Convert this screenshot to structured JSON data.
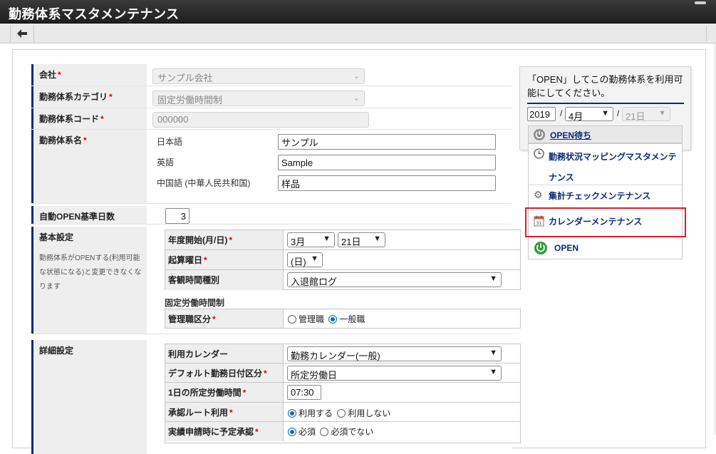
{
  "app": {
    "title": "勤務体系マスタメンテナンス"
  },
  "form": {
    "company": {
      "label": "会社",
      "value": "サンプル会社"
    },
    "category": {
      "label": "勤務体系カテゴリ",
      "value": "固定労働時間制"
    },
    "code": {
      "label": "勤務体系コード",
      "value": "000000"
    },
    "name": {
      "label": "勤務体系名",
      "langs": [
        {
          "lang": "日本語",
          "value": "サンプル"
        },
        {
          "lang": "英語",
          "value": "Sample"
        },
        {
          "lang": "中国語 (中華人民共和国)",
          "value": "样品"
        }
      ]
    },
    "auto_open": {
      "label": "自動OPEN基準日数",
      "value": "3"
    },
    "basic": {
      "label": "基本設定",
      "note": "勤務体系がOPENする(利用可能な状態になる)と変更できなくなります",
      "year_start": {
        "label": "年度開始(月/日)",
        "month": "3月",
        "day": "21日"
      },
      "week_start": {
        "label": "起算曜日",
        "value": "(日)"
      },
      "objective_time": {
        "label": "客観時間種別",
        "value": "入退館ログ"
      },
      "section_title": "固定労働時間制",
      "manager": {
        "label": "管理職区分",
        "options": [
          "管理職",
          "一般職"
        ],
        "selected": "一般職"
      }
    },
    "detail": {
      "label": "詳細設定",
      "calendar": {
        "label": "利用カレンダー",
        "value": "勤務カレンダー(一般)"
      },
      "default_day": {
        "label": "デフォルト勤務日付区分",
        "value": "所定労働日"
      },
      "daily_hours": {
        "label": "1日の所定労働時間",
        "value": "07:30"
      },
      "approval_route": {
        "label": "承認ルート利用",
        "options": [
          "利用する",
          "利用しない"
        ],
        "selected": "利用する"
      },
      "pre_approval": {
        "label": "実績申請時に予定承認",
        "options": [
          "必須",
          "必須でない"
        ],
        "selected": "必須"
      }
    }
  },
  "panel": {
    "message": "「OPEN」してこの勤務体系を利用可能にしてください。",
    "year": "2019",
    "month": "4月",
    "day": "21日",
    "status": "OPEN待ち",
    "menu": [
      {
        "label": "勤務状況マッピングマスタメンテナンス",
        "icon": "clock-icon"
      },
      {
        "label": "集計チェックメンテナンス",
        "icon": "gear-icon"
      },
      {
        "label": "カレンダーメンテナンス",
        "icon": "calendar-icon"
      },
      {
        "label": "OPEN",
        "icon": "power-icon"
      }
    ],
    "highlight_color": "#e01b24",
    "accent_color": "#0b2a7a"
  }
}
